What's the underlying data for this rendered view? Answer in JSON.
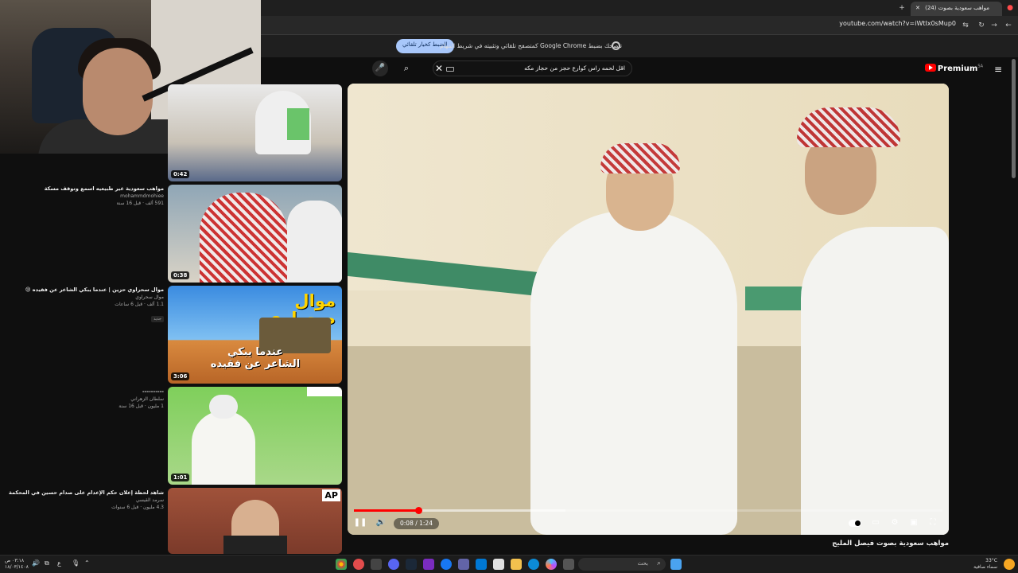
{
  "browser": {
    "tab_title": "(24) مواهب سعودية بصوت",
    "url": "youtube.com/watch?v=iWtIx0sMup0",
    "new_tab_label": "+",
    "close_tab_label": "✕"
  },
  "notification": {
    "text": "تنصحك بضبط Google Chrome كمتصفح تلقائي وتثبيته في شريط المهام",
    "button_label": "الضبط كخيار تلقائي"
  },
  "youtube": {
    "search_query": "اقل لحمه راس كوارع حجز من حجاز مكه",
    "logo_text": "Premium",
    "logo_region": "SA"
  },
  "sidebar": [
    {
      "title": "مواهب سعودية غير طبيعيه اسمع وتوقف مسكة",
      "channel": "mohammdmohiee",
      "views": "591 ألف",
      "age": "قبل 16 سنة",
      "duration": "0:42"
    },
    {
      "title": "",
      "channel": "",
      "views": "",
      "age": "",
      "duration": "0:38"
    },
    {
      "title": "موال سحراوي حزين | عندما يبكي الشاعر عن فقيده 😢",
      "channel": "موال سحراوي",
      "views": "1.1 ألف",
      "age": "قبل 6 ساعات",
      "badge": "جديد",
      "duration": "3:06",
      "thumb_text_1": "موال",
      "thumb_text_2": "صحراوي",
      "thumb_text_3": "عندما يبكي",
      "thumb_text_4": "الشاعر عن فقيده"
    },
    {
      "title": "----------",
      "channel": "سلطان الزهراني",
      "views": "1 مليون",
      "age": "قبل 16 سنة",
      "duration": "1:01"
    },
    {
      "title": "شاهد لحظة إعلان حكم الإعدام على صدام حسين في المحكمة",
      "channel": "سرمد القيسي",
      "views": "4.3 مليون",
      "age": "قبل 6 سنوات",
      "duration": "",
      "logo": "AP"
    }
  ],
  "player": {
    "time": "0:08 / 1:24",
    "played_fraction": 0.11,
    "loaded_fraction": 0.36
  },
  "video_title": "مواهب سعودية بصوت فيصل المليح",
  "taskbar": {
    "search_label": "بحث",
    "weather_temp": "33°C",
    "weather_text": "سماء صافية",
    "clock_time": "٠٣:١٨ ص",
    "clock_date": "١٨/٠٣/١٤٠٨",
    "lang": "ع"
  },
  "colors": {
    "yt_red": "#ff0000",
    "accent_blue": "#a8c7fa"
  }
}
